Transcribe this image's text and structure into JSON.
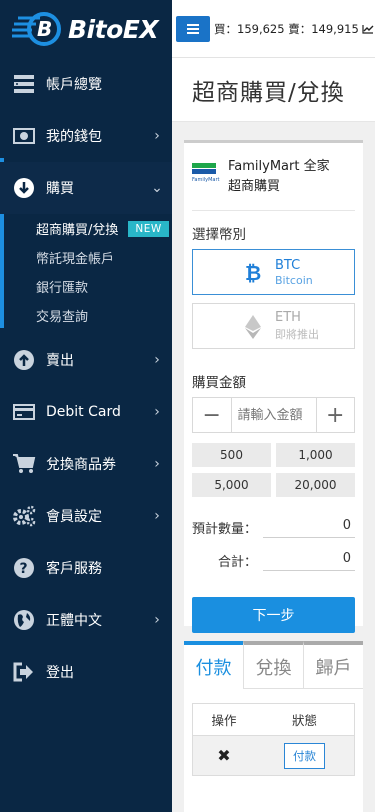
{
  "brand": {
    "name": "BitoEX"
  },
  "ticker": {
    "buy_label": "買",
    "buy_value": "159,625",
    "sell_label": "賣",
    "sell_value": "149,915",
    "text": "買：159,625 賣：149,915"
  },
  "sidebar": {
    "items": [
      {
        "label": "帳戶總覽",
        "icon": "dashboard-icon"
      },
      {
        "label": "我的錢包",
        "icon": "wallet-icon"
      },
      {
        "label": "購買",
        "icon": "download-circle-icon"
      },
      {
        "label": "賣出",
        "icon": "upload-circle-icon"
      },
      {
        "label": "Debit Card",
        "icon": "card-icon"
      },
      {
        "label": "兌換商品券",
        "icon": "cart-icon"
      },
      {
        "label": "會員設定",
        "icon": "gears-icon"
      },
      {
        "label": "客戶服務",
        "icon": "question-icon"
      },
      {
        "label": "正體中文",
        "icon": "globe-icon"
      },
      {
        "label": "登出",
        "icon": "logout-icon"
      }
    ],
    "sub_items": [
      {
        "label": "超商購買/兌換",
        "badge": "NEW"
      },
      {
        "label": "幣託現金帳戶"
      },
      {
        "label": "銀行匯款"
      },
      {
        "label": "交易查詢"
      }
    ]
  },
  "page": {
    "title": "超商購買/兌換"
  },
  "store": {
    "line1": "FamilyMart 全家",
    "line2": "超商購買",
    "logo_text": "FamilyMart"
  },
  "currency": {
    "label": "選擇幣別",
    "options": [
      {
        "code": "BTC",
        "sub": "Bitcoin",
        "selected": true
      },
      {
        "code": "ETH",
        "sub": "即將推出",
        "selected": false
      }
    ]
  },
  "amount": {
    "label": "購買金額",
    "placeholder": "請輸入金額",
    "minus": "−",
    "plus": "+",
    "quick": [
      "500",
      "1,000",
      "5,000",
      "20,000"
    ]
  },
  "calc": {
    "qty_label": "預計數量：",
    "qty_value": "0",
    "total_label": "合計：",
    "total_value": "0"
  },
  "next_label": "下一步",
  "tabs": {
    "items": [
      "付款",
      "兌換",
      "歸戶"
    ],
    "active": 0
  },
  "table": {
    "headers": [
      "操作",
      "狀態"
    ],
    "rows": [
      {
        "action": "✖",
        "status": "付款"
      }
    ]
  },
  "colors": {
    "sidebar": "#0a2744",
    "accent": "#1a8fe0",
    "badge": "#29b6c8",
    "btc": "#1f7fd8"
  }
}
